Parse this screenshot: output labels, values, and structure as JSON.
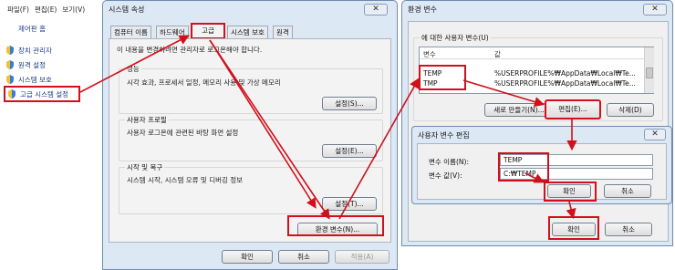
{
  "control_panel": {
    "menu": [
      "파일(F)",
      "편집(E)",
      "보기(V)"
    ],
    "home": "제어판 홈",
    "items": [
      {
        "label": "장치 관리자",
        "icon": "shield-icon"
      },
      {
        "label": "원격 설정",
        "icon": "shield-icon"
      },
      {
        "label": "시스템 보호",
        "icon": "shield-icon"
      },
      {
        "label": "고급 시스템 설정",
        "icon": "shield-icon"
      }
    ]
  },
  "sysprops": {
    "title": "시스템 속성",
    "close": "✕",
    "tabs": [
      "컴퓨터 이름",
      "하드웨어",
      "고급",
      "시스템 보호",
      "원격"
    ],
    "active_tab": "고급",
    "admin_note": "이 내용을 변경하려면 관리자로 로그온해야 합니다.",
    "perf": {
      "label": "성능",
      "text": "시각 효과, 프로세서 일정, 메모리 사용 및 가상 메모리",
      "button": "설정(S)..."
    },
    "profile": {
      "label": "사용자 프로필",
      "text": "사용자 로그온에 관련된 바탕 화면 설정",
      "button": "설정(E)..."
    },
    "startup": {
      "label": "시작 및 복구",
      "text": "시스템 시작, 시스템 오류 및 디버깅 정보",
      "button": "설정(T)..."
    },
    "env_button": "환경 변수(N)...",
    "ok": "확인",
    "cancel": "취소",
    "apply": "적용(A)"
  },
  "envvars": {
    "title": "환경 변수",
    "close": "✕",
    "user_group": "에 대한 사용자 변수(U)",
    "columns": [
      "변수",
      "값"
    ],
    "rows": [
      {
        "name": "TEMP",
        "value": "%USERPROFILE%₩AppData₩Local₩Te..."
      },
      {
        "name": "TMP",
        "value": "%USERPROFILE%₩AppData₩Local₩Te..."
      }
    ],
    "new_button": "새로 만들기(N)...",
    "edit_button": "편집(E)...",
    "delete_button": "삭제(D)",
    "ok": "확인",
    "cancel": "취소"
  },
  "editvar": {
    "title": "사용자 변수 편집",
    "close": "✕",
    "name_label": "변수 이름(N):",
    "name_value": "TEMP",
    "value_label": "변수 값(V):",
    "value_value": "C:₩TEMP",
    "ok": "확인",
    "cancel": "취소"
  },
  "colors": {
    "highlight": "#d0101b",
    "window_frame": "#dce8f4"
  }
}
